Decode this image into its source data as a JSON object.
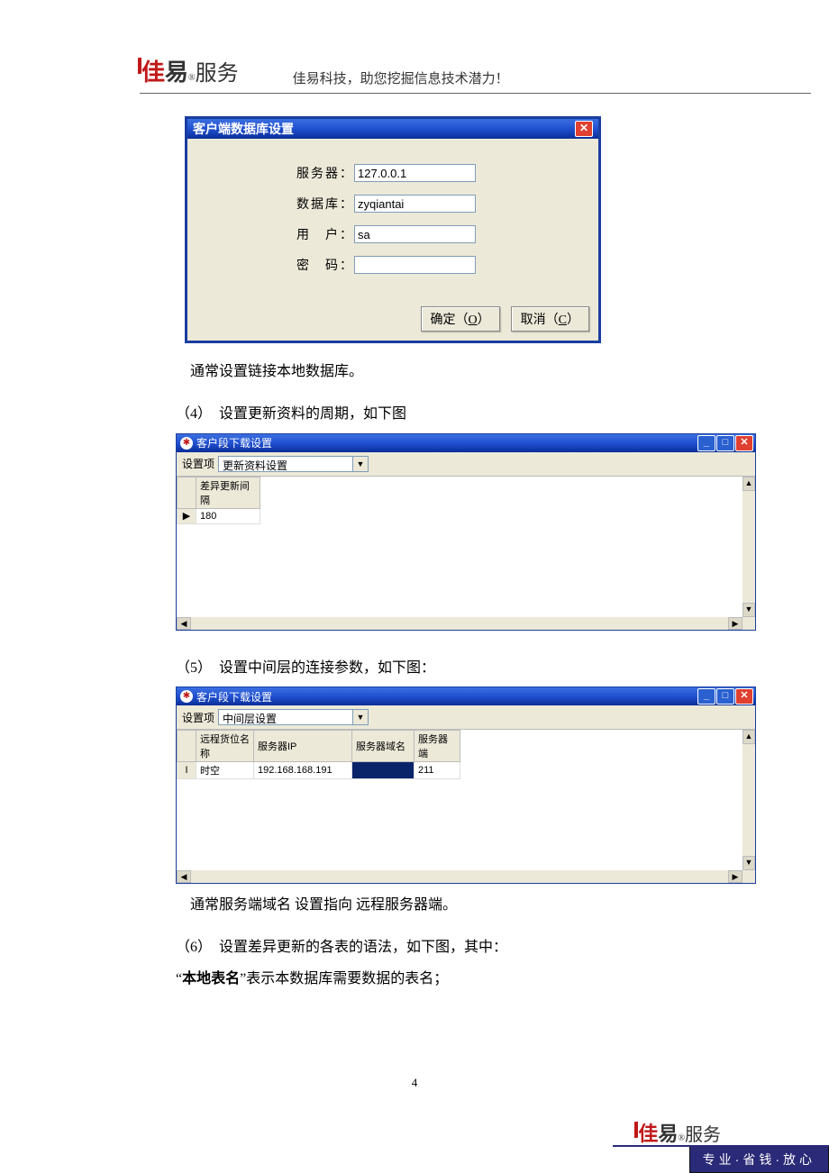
{
  "header": {
    "logo_jia": "佳",
    "logo_yi": "易",
    "logo_reg": "®",
    "logo_service": "服务",
    "tagline": "佳易科技，助您挖掘信息技术潜力！"
  },
  "dialog1": {
    "title": "客户端数据库设置",
    "close": "✕",
    "fields": {
      "server_label": "服务器：",
      "server_value": "127.0.0.1",
      "db_label": "数据库：",
      "db_value": "zyqiantai",
      "user_label": "用　户：",
      "user_value": "sa",
      "pwd_label": "密　码：",
      "pwd_value": ""
    },
    "ok_btn": "确定（",
    "ok_key": "O",
    "ok_end": "）",
    "cancel_btn": "取消（",
    "cancel_key": "C",
    "cancel_end": "）"
  },
  "text1": "　通常设置链接本地数据库。",
  "step4": "（4）　设置更新资料的周期，如下图",
  "window2": {
    "title": "客户段下载设置",
    "toolbar_label": "设置项",
    "dropdown_value": "更新资料设置",
    "col1": "差异更新间隔",
    "row1_mark": "▶",
    "row1_value": "180"
  },
  "step5": "（5）　设置中间层的连接参数，如下图：",
  "window3": {
    "title": "客户段下载设置",
    "toolbar_label": "设置项",
    "dropdown_value": "中间层设置",
    "cols": [
      "远程货位名称",
      "服务器IP",
      "服务器域名",
      "服务器端"
    ],
    "row_mark": "I",
    "row": [
      "时空",
      "192.168.168.191",
      "",
      "211"
    ]
  },
  "text2": "　通常服务端域名 设置指向 远程服务器端。",
  "step6_a": "（6）　设置差异更新的各表的语法，如下图，其中：",
  "step6_b1": "“",
  "step6_bold": "本地表名",
  "step6_b2": "”表示本数据库需要数据的表名；",
  "page_number": "4",
  "footer": {
    "logo_jia": "佳",
    "logo_yi": "易",
    "logo_reg": "®",
    "logo_service": "服务",
    "line": "专业·省钱·放心"
  }
}
